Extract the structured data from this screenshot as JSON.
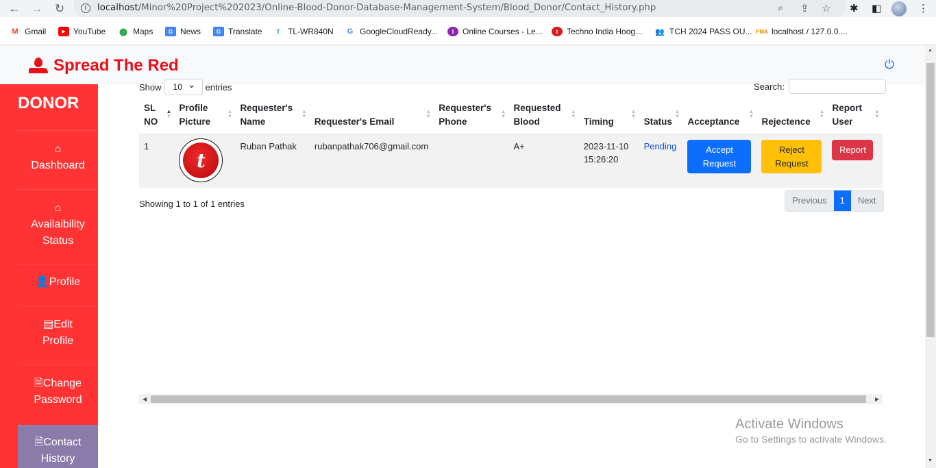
{
  "browser": {
    "url_host": "localhost",
    "url_path": "/Minor%20Project%202023/Online-Blood-Donor-Database-Management-System/Blood_Donor/Contact_History.php",
    "bookmarks": [
      "Gmail",
      "YouTube",
      "Maps",
      "News",
      "Translate",
      "TL-WR840N",
      "GoogleCloudReady...",
      "Online Courses - Le...",
      "Techno India Hoog...",
      "TCH 2024 PASS OU...",
      "localhost / 127.0.0...."
    ]
  },
  "header": {
    "brand": "Spread The Red"
  },
  "sidebar": {
    "title": "DONOR",
    "items": [
      {
        "label": "Dashboard"
      },
      {
        "label_1": "Availaibility",
        "label_2": "Status"
      },
      {
        "label": "Profile"
      },
      {
        "label_1": "Edit",
        "label_2": "Profile"
      },
      {
        "label_1": "Change",
        "label_2": "Password"
      },
      {
        "label_1": "Contact",
        "label_2": "History"
      }
    ]
  },
  "table_controls": {
    "show_label": "Show",
    "entries_value": "10",
    "entries_label": "entries",
    "search_label": "Search:"
  },
  "table": {
    "headers": [
      {
        "l1": "SL",
        "l2": "NO"
      },
      {
        "l1": "Profile",
        "l2": "Picture"
      },
      {
        "l1": "Requester's",
        "l2": "Name"
      },
      {
        "l1": "",
        "l2": "Requester's Email"
      },
      {
        "l1": "Requester's",
        "l2": "Phone"
      },
      {
        "l1": "Requested",
        "l2": "Blood"
      },
      {
        "l1": "",
        "l2": "Timing"
      },
      {
        "l1": "",
        "l2": "Status"
      },
      {
        "l1": "",
        "l2": "Acceptance"
      },
      {
        "l1": "",
        "l2": "Rejectence"
      },
      {
        "l1": "Report",
        "l2": "User"
      }
    ],
    "rows": [
      {
        "sl": "1",
        "name": "Ruban Pathak",
        "email": "rubanpathak706@gmail.com",
        "phone": "",
        "blood": "A+",
        "timing_date": "2023-11-10",
        "timing_time": "15:26:20",
        "status": "Pending",
        "accept_l1": "Accept",
        "accept_l2": "Request",
        "reject_l1": "Reject",
        "reject_l2": "Request",
        "report": "Report"
      }
    ]
  },
  "info": "Showing 1 to 1 of 1 entries",
  "pagination": {
    "prev": "Previous",
    "current": "1",
    "next": "Next"
  },
  "watermark": {
    "line1": "Activate Windows",
    "line2": "Go to Settings to activate Windows."
  },
  "colors": {
    "sidebar": "#ff3333",
    "brand": "#e8101a",
    "primary": "#0d6efd",
    "warning": "#ffc107",
    "danger": "#dc3545"
  }
}
